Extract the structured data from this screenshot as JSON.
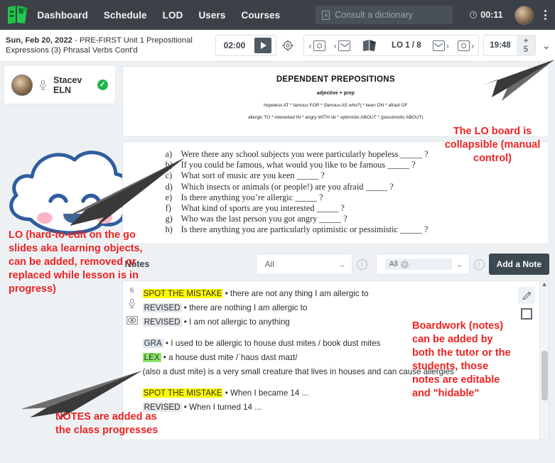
{
  "topnav": {
    "logo_icon": "green-book-logo-icon",
    "links": [
      {
        "label": "Dashboard"
      },
      {
        "label": "Schedule"
      },
      {
        "label": "LOD"
      },
      {
        "label": "Users"
      },
      {
        "label": "Courses"
      }
    ],
    "dictionary_placeholder": "Consult a dictionary",
    "dictionary_value": "",
    "dictionary_icon": "dictionary-book-icon",
    "clock_icon": "clock-icon",
    "clock_time": "00:11",
    "avatar_icon": "user-avatar",
    "menu_icon": "kebab-menu-icon"
  },
  "subbar": {
    "lesson_date": "Sun, Feb 20, 2022",
    "lesson_sep": " - ",
    "lesson_name": "PRE-FIRST Unit 1 Prepositional Expressions (3) Phrasal Verbs Cont'd",
    "timer_value": "02:00",
    "play_icon": "play-icon",
    "settings_icon": "gear-icon",
    "prev_eye_icon": "prev-reveal-icon",
    "prev_mail_icon": "prev-envelope-icon",
    "book_icon": "open-book-icon",
    "lo_counter": "LO 1 / 8",
    "next_mail_icon": "next-envelope-icon",
    "next_eye_icon": "next-reveal-icon",
    "elapsed_time": "19:48",
    "plus_badge": "+ 5",
    "collapse_icon": "chevron-down-icon"
  },
  "sidebar": {
    "student": {
      "avatar_icon": "student-avatar",
      "mic_icon": "microphone-icon",
      "name": "Stacev ELN",
      "status_icon": "check-circle-icon",
      "status": "✓"
    },
    "mascot_icon": "cloud-mascot-icon"
  },
  "board": {
    "lo_title": "DEPENDENT PREPOSITIONS",
    "lo_subtitle": "adjective + prep",
    "lo_line_1": "hopeless AT * famous FOR * (famous AS who?) * keen ON * afraid OF",
    "lo_line_2": "allergic TO * interested IN * angry WITH sb * optimistic ABOUT * (pessimistic ABOUT)",
    "questions": [
      {
        "letter": "a)",
        "text": "Were there any school subjects you were particularly hopeless _____ ?"
      },
      {
        "letter": "b)",
        "text": "If you could be famous, what would you like to be famous _____ ?"
      },
      {
        "letter": "c)",
        "text": "What sort of music are you keen _____ ?"
      },
      {
        "letter": "d)",
        "text": "Which insects or animals (or people!) are you afraid _____ ?"
      },
      {
        "letter": "e)",
        "text": "Is there anything you’re allergic _____ ?"
      },
      {
        "letter": "f)",
        "text": "What kind of sports are you interested _____ ?"
      },
      {
        "letter": "g)",
        "text": "Who was the last person you got angry _____ ?"
      },
      {
        "letter": "h)",
        "text": "Is there anything you are particularly optimistic or pessimistic _____ ?"
      }
    ]
  },
  "notes_toolbar": {
    "label": "Notes",
    "filter_1_value": "All",
    "filter_1_caret": "chevron-down-icon",
    "filter_1_info": "i",
    "filter_2_chip": "All",
    "filter_2_chip_remove": "×",
    "filter_2_caret": "chevron-down-icon",
    "filter_2_info": "i",
    "add_note_label": "Add a Note"
  },
  "notes_panel": {
    "gutter_number": "6",
    "gutter_mic_icon": "microphone-icon",
    "gutter_eye_icon": "eye-icon",
    "edit_icon": "pencil-icon",
    "hide_icon": "checkbox-icon",
    "scroll_up_icon": "scroll-up-arrow-icon",
    "blocks": [
      {
        "lines": [
          {
            "tag": "SPOT THE MISTAKE",
            "tag_style": "yellow",
            "body": " • there are not any thing I am allergic to"
          },
          {
            "tag": "REVISED",
            "tag_style": "grey",
            "body": " • there are nothing I am allergic to"
          },
          {
            "tag": "REVISED",
            "tag_style": "grey",
            "body": " • I am not allergic to anything"
          }
        ]
      },
      {
        "lines": [
          {
            "tag": "GRA",
            "tag_style": "blue",
            "body": " • I used to be allergic to house dust mites / book dust mites"
          },
          {
            "tag": "LEX",
            "tag_style": "green",
            "body": " • a house dust mite  /ˈhaʊs dʌst maɪt/"
          },
          {
            "tag": "",
            "tag_style": "none",
            "body": "(also a dust mite) is a very small creature that lives in houses and can cause allergies"
          }
        ]
      },
      {
        "lines": [
          {
            "tag": "SPOT THE MISTAKE",
            "tag_style": "yellow",
            "body": " • When I became 14 ..."
          },
          {
            "tag": "REVISED",
            "tag_style": "grey",
            "body": " • When I turned 14 ..."
          }
        ]
      }
    ]
  },
  "annotations": [
    {
      "id": "anno-lo-collapsible",
      "text": "The LO board is collapsible (manual control)",
      "color": "#ee2222"
    },
    {
      "id": "anno-lo-slides",
      "text": "LO (hard-to-edit on the go slides aka learning objects, can be added, removed  or replaced while lesson is in progress)",
      "color": "#ee2222"
    },
    {
      "id": "anno-notes-added",
      "text": "NOTES are added as the class progresses",
      "color": "#ee2222"
    },
    {
      "id": "anno-boardwork",
      "text": "Boardwork (notes) can be added by both the tutor or the students, those notes are editable and \"hidable\"",
      "color": "#ee2222"
    }
  ],
  "colors": {
    "topnav_bg": "#3c4148",
    "accent_green": "#24b24c",
    "annotation_red": "#ee2222",
    "button_dark": "#3c4950",
    "highlight_yellow": "#fffb00",
    "page_bg": "#eef1f4"
  }
}
